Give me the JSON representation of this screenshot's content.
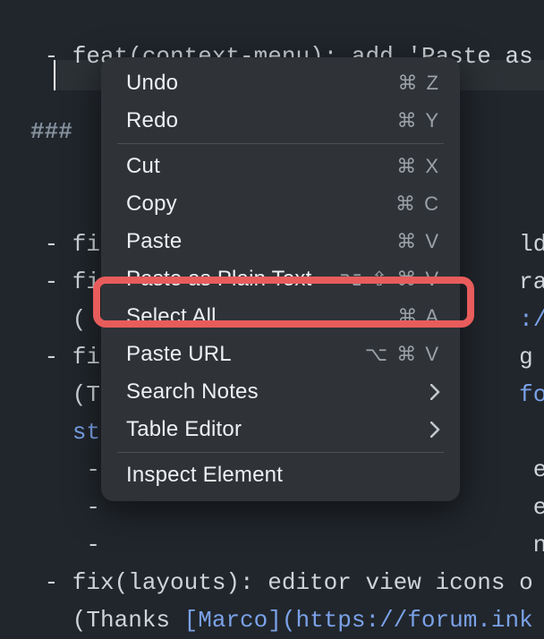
{
  "editor": {
    "line1_text": " - feat(context-menu): add 'Paste as",
    "heading_hashes": "###",
    "line_fix1": " - fix                             ld n",
    "line_fix2a": " - fi                              rant",
    "line_fix2b": "   (                               ://f",
    "line_fix3a": " - fi                              g so",
    "line_fix3b": "   (T                              forum",
    "line_fix3c": "   st",
    "line_sub1": "    -                               e wh",
    "line_sub2": "    -                               e in",
    "line_sub3": "    -                               n fa",
    "line_fix4a": " - fix(layouts): editor view icons o",
    "line_fix4b": "   (Thanks ",
    "link_marco": "[Marco]",
    "link_url_frag": "(https://forum.ink"
  },
  "menu": {
    "undo": {
      "label": "Undo",
      "shortcut": "⌘ Z"
    },
    "redo": {
      "label": "Redo",
      "shortcut": "⌘ Y"
    },
    "cut": {
      "label": "Cut",
      "shortcut": "⌘ X"
    },
    "copy": {
      "label": "Copy",
      "shortcut": "⌘ C"
    },
    "paste": {
      "label": "Paste",
      "shortcut": "⌘ V"
    },
    "paste_plain": {
      "label": "Paste as Plain Text",
      "shortcut": "⌥ ⇧ ⌘ V"
    },
    "select_all": {
      "label": "Select All",
      "shortcut": "⌘ A"
    },
    "paste_url": {
      "label": "Paste URL",
      "shortcut": "⌥ ⌘ V"
    },
    "search_notes": {
      "label": "Search Notes"
    },
    "table_editor": {
      "label": "Table Editor"
    },
    "inspect": {
      "label": "Inspect Element"
    }
  }
}
